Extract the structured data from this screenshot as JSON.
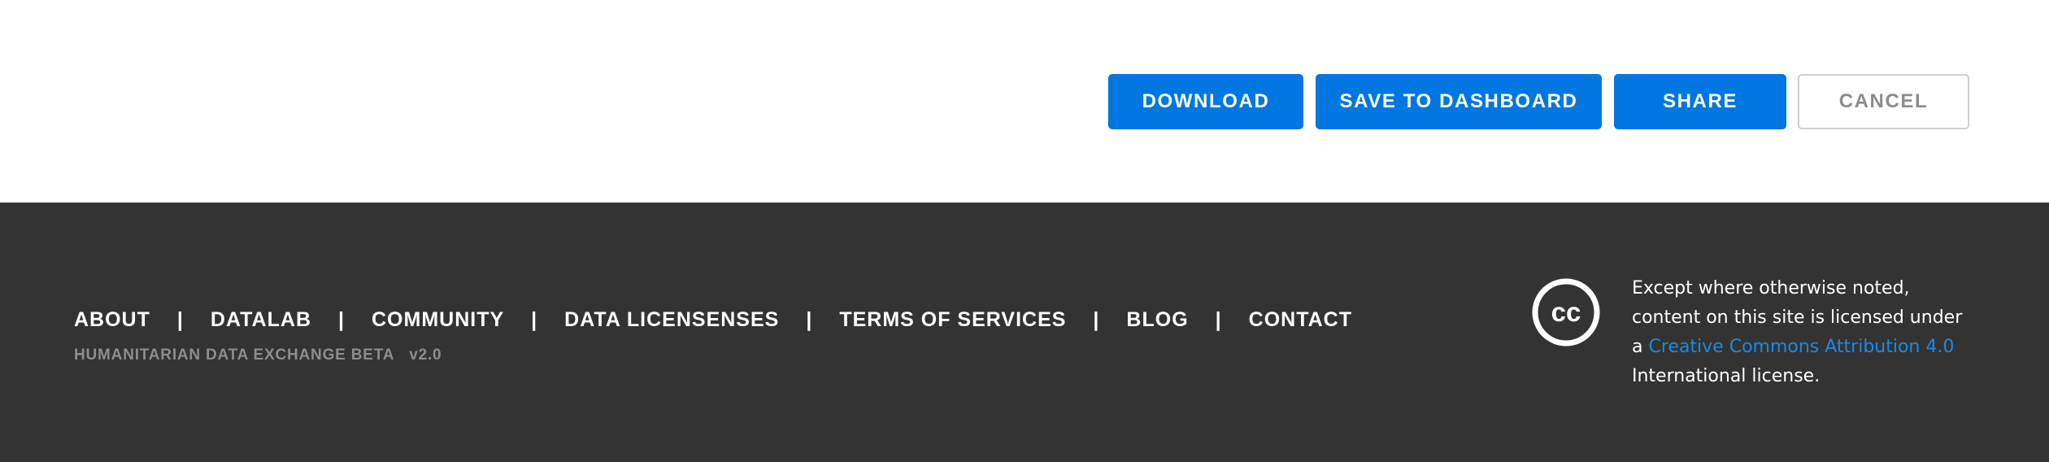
{
  "actions": {
    "download_label": "DOWNLOAD",
    "save_label": "SAVE TO DASHBOARD",
    "share_label": "SHARE",
    "cancel_label": "CANCEL"
  },
  "footer": {
    "nav": [
      {
        "label": "ABOUT"
      },
      {
        "label": "DATALAB"
      },
      {
        "label": "COMMUNITY"
      },
      {
        "label": "DATA LICENSENSES"
      },
      {
        "label": "TERMS OF SERVICES"
      },
      {
        "label": "BLOG"
      },
      {
        "label": "CONTACT"
      }
    ],
    "separator": "|",
    "brand": "HUMANITARIAN DATA EXCHANGE BETA",
    "version": "v2.0",
    "cc_icon": "creative-commons-icon",
    "license": {
      "line1": "Except where otherwise noted,",
      "line2": "content on this site is licensed under",
      "line3_prefix": "a",
      "link_text": "Creative Commons Attribution 4.0",
      "line4": "International license."
    }
  },
  "colors": {
    "primary": "#0077e0",
    "footer_bg": "#333333",
    "link": "#1a8ae6",
    "muted": "#8d8d8d"
  }
}
